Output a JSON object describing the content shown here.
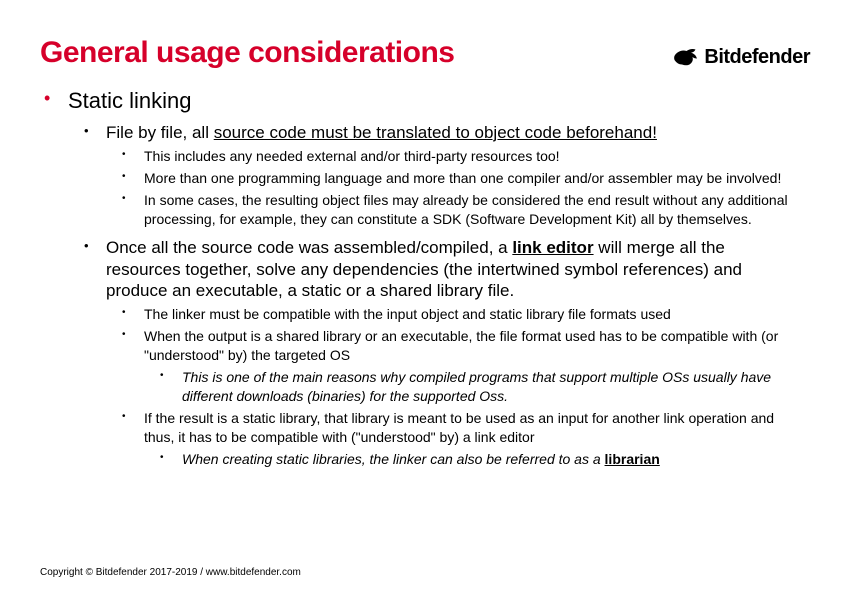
{
  "title": "General usage considerations",
  "brand": "Bitdefender",
  "lvl1": {
    "text": "Static linking"
  },
  "sec1": {
    "heading_pre": "File by file, all ",
    "heading_u": "source code must be translated to object code beforehand!",
    "b1": "This includes any needed external and/or third-party resources too!",
    "b2": "More than one programming language and more than one compiler and/or assembler may be involved!",
    "b3": "In some cases, the resulting object files may already be considered the end result without any additional processing, for example, they can constitute a SDK (Software Development Kit) all by themselves."
  },
  "sec2": {
    "heading_pre": "Once all the source code was assembled/compiled, a ",
    "heading_bold": "link editor",
    "heading_post": " will merge all the resources together, solve any dependencies (the intertwined symbol references) and produce an executable, a static or a shared library file.",
    "b1": "The linker must be compatible with the input object and static library file formats used",
    "b2": "When the output is a shared library or an executable, the file format used has to be compatible with (or \"understood\" by) the targeted OS",
    "b2_sub": "This is one of the main reasons why compiled programs that support multiple OSs usually have different downloads (binaries) for the supported Oss.",
    "b3": "If the result is a static library, that library is meant to be used as an input for another link operation and thus, it has to be compatible with (\"understood\" by) a link editor",
    "b3_sub_pre": "When creating static libraries, the linker can also be referred to as a ",
    "b3_sub_bold": "librarian"
  },
  "footer": "Copyright © Bitdefender 2017-2019 / www.bitdefender.com"
}
